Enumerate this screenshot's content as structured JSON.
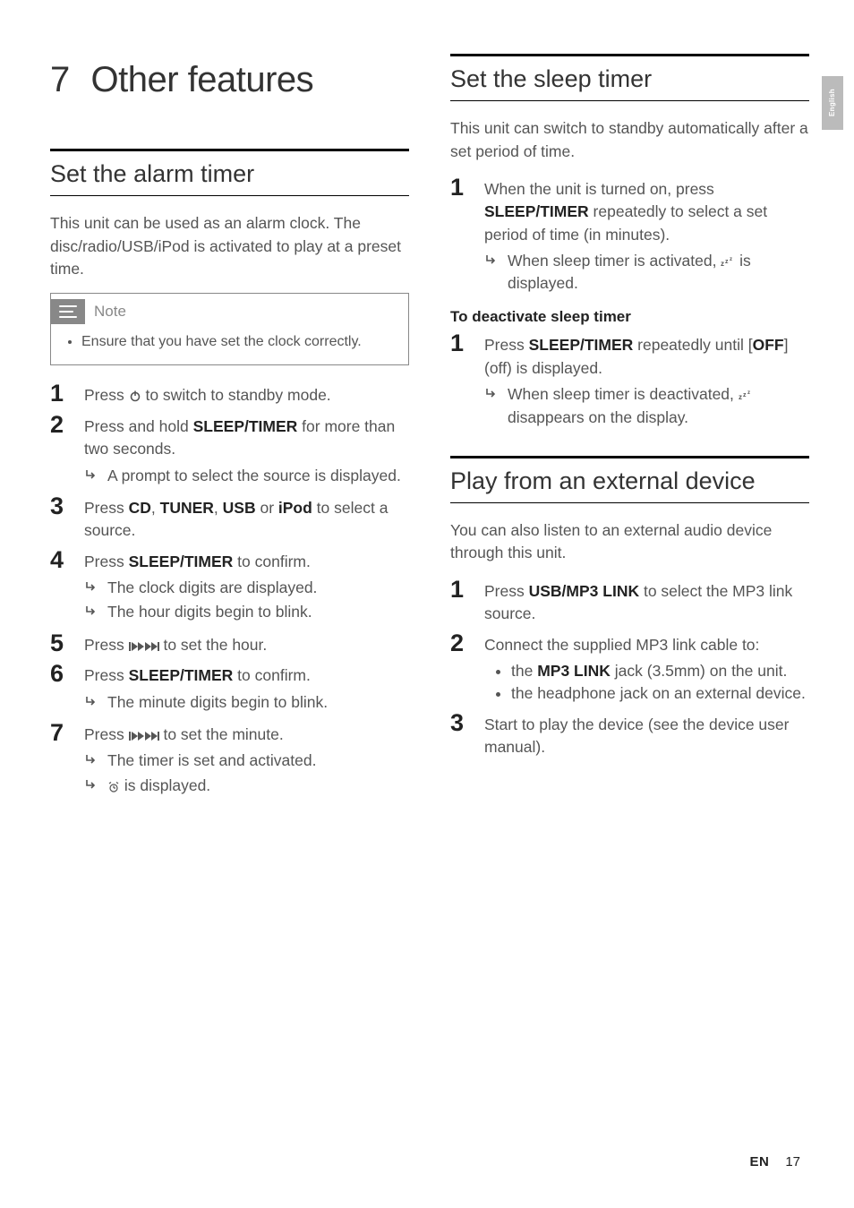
{
  "vtab": "English",
  "chapter": {
    "number": "7",
    "title": "Other features"
  },
  "left": {
    "h2": "Set the alarm timer",
    "intro": "This unit can be used as an alarm clock. The disc/radio/USB/iPod is activated to play at a preset time.",
    "note": {
      "label": "Note",
      "items": [
        "Ensure that you have set the clock correctly."
      ]
    },
    "steps": [
      {
        "n": "1",
        "pre": "Press ",
        "icon": "power",
        "post": " to switch to standby mode."
      },
      {
        "n": "2",
        "pre": "Press and hold ",
        "bold": "SLEEP/TIMER",
        "post": " for more than two seconds.",
        "sub": [
          "A prompt to select the source is displayed."
        ]
      },
      {
        "n": "3",
        "pre": "Press ",
        "bold": "CD",
        "mid1": ", ",
        "bold2": "TUNER",
        "mid2": ", ",
        "bold3": "USB",
        "mid3": " or ",
        "bold4": "iPod",
        "post": " to select a source."
      },
      {
        "n": "4",
        "pre": "Press ",
        "bold": "SLEEP/TIMER",
        "post": " to confirm.",
        "sub": [
          "The clock digits are displayed.",
          "The hour digits begin to blink."
        ]
      },
      {
        "n": "5",
        "pre": "Press ",
        "icon": "skip",
        "post": " to set the hour."
      },
      {
        "n": "6",
        "pre": "Press ",
        "bold": "SLEEP/TIMER",
        "post": " to confirm.",
        "sub": [
          "The minute digits begin to blink."
        ]
      },
      {
        "n": "7",
        "pre": "Press ",
        "icon": "skip",
        "post": " to set the minute.",
        "sub": [
          "The timer is set and activated."
        ],
        "sub_icon": [
          {
            "icon": "alarm",
            "post": " is displayed."
          }
        ]
      }
    ]
  },
  "right": {
    "sleep": {
      "h2": "Set the sleep timer",
      "intro": "This unit can switch to standby automatically after a set period of time.",
      "steps": [
        {
          "n": "1",
          "pre": "When the unit is turned on, press ",
          "bold": "SLEEP/TIMER",
          "post": " repeatedly to select a set period of time (in minutes).",
          "sub_icon": [
            {
              "pre": "When sleep timer is activated, ",
              "icon": "zzz",
              "post": " is displayed."
            }
          ]
        }
      ],
      "deact_head": "To deactivate sleep timer",
      "deact_steps": [
        {
          "n": "1",
          "pre": "Press ",
          "bold": "SLEEP/TIMER",
          "post_a": " repeatedly until [",
          "bold2": "OFF",
          "post_b": "] (off) is displayed.",
          "sub_icon": [
            {
              "pre": "When sleep timer is deactivated, ",
              "icon": "zzz",
              "post": " disappears on the display."
            }
          ]
        }
      ]
    },
    "ext": {
      "h2": "Play from an external device",
      "intro": "You can also listen to an external audio device through this unit.",
      "steps": [
        {
          "n": "1",
          "pre": "Press ",
          "bold": "USB/MP3 LINK",
          "post": " to select the MP3 link source."
        },
        {
          "n": "2",
          "pre": "Connect the supplied MP3 link cable to:",
          "bul": [
            {
              "pre": "the ",
              "bold": "MP3 LINK",
              "post": " jack (3.5mm) on the unit."
            },
            {
              "text": "the headphone jack on an external device."
            }
          ]
        },
        {
          "n": "3",
          "pre": "Start to play the device (see the device user manual)."
        }
      ]
    }
  },
  "footer": {
    "lang": "EN",
    "page": "17"
  }
}
